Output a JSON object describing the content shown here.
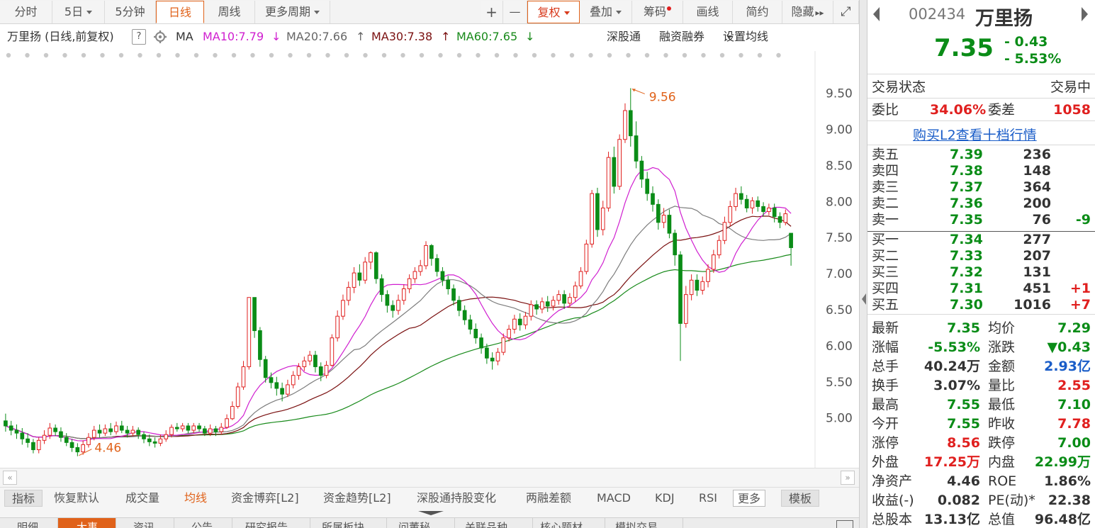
{
  "toolbar": {
    "tabs": [
      "分时",
      "5日",
      "5分钟",
      "日线",
      "周线",
      "更多周期"
    ],
    "active_tab": "日线",
    "zoom_in": "+",
    "zoom_out": "—",
    "fuquan": "复权",
    "overlay": "叠加",
    "chips": "筹码",
    "draw": "画线",
    "simple": "简约",
    "hide": "隐藏",
    "hide_arrows": "▸▸",
    "expand": "⤢"
  },
  "legend": {
    "stock_label": "万里扬 (日线,前复权)",
    "help": "?",
    "ma_label": "MA",
    "ma10": "MA10:7.79",
    "ma10_arrow": "↓",
    "ma20": "MA20:7.66",
    "ma20_arrow": "↑",
    "ma30": "MA30:7.38",
    "ma30_arrow": "↑",
    "ma60": "MA60:7.65",
    "ma60_arrow": "↓",
    "link_sgt": "深股通",
    "link_rzrq": "融资融券",
    "link_ma": "设置均线"
  },
  "colors": {
    "up": "#e0201f",
    "down": "#0a8c17",
    "ma10": "#d01fd0",
    "ma20": "#7d7d7d",
    "ma30": "#7a1010",
    "ma60": "#188a1a",
    "accent": "#e0621a",
    "link": "#1a5dc8"
  },
  "chart_data": {
    "type": "candlestick",
    "y_ticks": [
      "9.50",
      "9.00",
      "8.50",
      "8.00",
      "7.50",
      "7.00",
      "6.50",
      "6.00",
      "5.50",
      "5.00"
    ],
    "ylim": [
      4.3,
      9.8
    ],
    "high_label": "9.56",
    "low_label": "4.46",
    "high_value": 9.56,
    "low_value": 4.46,
    "candles": [
      [
        4.95,
        4.88,
        5.05,
        4.8
      ],
      [
        4.88,
        4.82,
        4.95,
        4.75
      ],
      [
        4.82,
        4.78,
        4.9,
        4.7
      ],
      [
        4.78,
        4.7,
        4.85,
        4.62
      ],
      [
        4.7,
        4.65,
        4.78,
        4.58
      ],
      [
        4.65,
        4.55,
        4.7,
        4.5
      ],
      [
        4.55,
        4.68,
        4.72,
        4.5
      ],
      [
        4.68,
        4.75,
        4.82,
        4.63
      ],
      [
        4.75,
        4.85,
        4.92,
        4.7
      ],
      [
        4.85,
        4.8,
        4.9,
        4.74
      ],
      [
        4.8,
        4.72,
        4.86,
        4.66
      ],
      [
        4.72,
        4.65,
        4.78,
        4.6
      ],
      [
        4.65,
        4.58,
        4.7,
        4.52
      ],
      [
        4.58,
        4.52,
        4.64,
        4.46
      ],
      [
        4.52,
        4.62,
        4.68,
        4.48
      ],
      [
        4.62,
        4.72,
        4.78,
        4.58
      ],
      [
        4.72,
        4.82,
        4.88,
        4.68
      ],
      [
        4.82,
        4.78,
        4.9,
        4.72
      ],
      [
        4.78,
        4.84,
        4.9,
        4.74
      ],
      [
        4.84,
        4.8,
        4.92,
        4.75
      ],
      [
        4.8,
        4.88,
        4.94,
        4.76
      ],
      [
        4.88,
        4.82,
        4.95,
        4.78
      ],
      [
        4.82,
        4.78,
        4.88,
        4.72
      ],
      [
        4.78,
        4.82,
        4.88,
        4.74
      ],
      [
        4.82,
        4.76,
        4.86,
        4.7
      ],
      [
        4.76,
        4.7,
        4.8,
        4.64
      ],
      [
        4.7,
        4.66,
        4.76,
        4.6
      ],
      [
        4.66,
        4.64,
        4.72,
        4.58
      ],
      [
        4.64,
        4.7,
        4.76,
        4.6
      ],
      [
        4.7,
        4.76,
        4.82,
        4.66
      ],
      [
        4.76,
        4.86,
        4.9,
        4.72
      ],
      [
        4.86,
        4.84,
        4.92,
        4.8
      ],
      [
        4.84,
        4.88,
        4.92,
        4.8
      ],
      [
        4.88,
        4.82,
        4.92,
        4.78
      ],
      [
        4.82,
        4.88,
        4.92,
        4.78
      ],
      [
        4.88,
        4.84,
        4.92,
        4.8
      ],
      [
        4.84,
        4.78,
        4.88,
        4.74
      ],
      [
        4.78,
        4.84,
        4.9,
        4.74
      ],
      [
        4.84,
        4.8,
        4.88,
        4.74
      ],
      [
        4.8,
        4.86,
        4.92,
        4.76
      ],
      [
        4.86,
        4.98,
        5.04,
        4.84
      ],
      [
        4.98,
        5.15,
        5.22,
        4.96
      ],
      [
        5.15,
        5.42,
        5.48,
        5.12
      ],
      [
        5.42,
        5.7,
        5.78,
        5.38
      ],
      [
        5.7,
        6.66,
        6.66,
        5.66
      ],
      [
        6.66,
        6.2,
        6.66,
        6.1
      ],
      [
        6.2,
        5.8,
        6.25,
        5.7
      ],
      [
        5.8,
        5.55,
        5.85,
        5.48
      ],
      [
        5.55,
        5.48,
        5.62,
        5.4
      ],
      [
        5.48,
        5.4,
        5.56,
        5.3
      ],
      [
        5.4,
        5.32,
        5.48,
        5.22
      ],
      [
        5.32,
        5.45,
        5.52,
        5.28
      ],
      [
        5.45,
        5.58,
        5.64,
        5.4
      ],
      [
        5.58,
        5.7,
        5.75,
        5.52
      ],
      [
        5.7,
        5.78,
        5.84,
        5.64
      ],
      [
        5.78,
        5.86,
        5.92,
        5.72
      ],
      [
        5.86,
        5.7,
        5.92,
        5.62
      ],
      [
        5.7,
        5.58,
        5.76,
        5.5
      ],
      [
        5.58,
        5.72,
        5.78,
        5.54
      ],
      [
        5.72,
        6.1,
        6.15,
        5.7
      ],
      [
        6.1,
        6.4,
        6.48,
        6.05
      ],
      [
        6.4,
        6.62,
        6.7,
        6.35
      ],
      [
        6.62,
        6.8,
        6.88,
        6.55
      ],
      [
        6.8,
        7.0,
        7.08,
        6.72
      ],
      [
        7.0,
        6.9,
        7.12,
        6.82
      ],
      [
        6.9,
        7.15,
        7.22,
        6.85
      ],
      [
        7.15,
        7.28,
        7.3,
        7.05
      ],
      [
        7.28,
        6.92,
        7.3,
        6.85
      ],
      [
        6.92,
        6.7,
        6.98,
        6.6
      ],
      [
        6.7,
        6.55,
        6.76,
        6.45
      ],
      [
        6.55,
        6.48,
        6.62,
        6.38
      ],
      [
        6.48,
        6.62,
        6.7,
        6.42
      ],
      [
        6.62,
        6.78,
        6.84,
        6.56
      ],
      [
        6.78,
        6.92,
        6.98,
        6.72
      ],
      [
        6.92,
        7.02,
        7.08,
        6.86
      ],
      [
        7.02,
        7.1,
        7.18,
        6.96
      ],
      [
        7.1,
        7.38,
        7.44,
        7.05
      ],
      [
        7.38,
        7.2,
        7.4,
        7.1
      ],
      [
        7.2,
        7.02,
        7.26,
        6.95
      ],
      [
        7.02,
        6.9,
        7.08,
        6.82
      ],
      [
        6.9,
        6.78,
        6.96,
        6.7
      ],
      [
        6.78,
        6.62,
        6.84,
        6.55
      ],
      [
        6.62,
        6.48,
        6.68,
        6.4
      ],
      [
        6.48,
        6.35,
        6.55,
        6.28
      ],
      [
        6.35,
        6.22,
        6.42,
        6.15
      ],
      [
        6.22,
        6.1,
        6.3,
        6.02
      ],
      [
        6.1,
        5.96,
        6.16,
        5.88
      ],
      [
        5.96,
        5.82,
        6.02,
        5.74
      ],
      [
        5.82,
        5.78,
        5.9,
        5.66
      ],
      [
        5.78,
        5.9,
        5.96,
        5.72
      ],
      [
        5.9,
        6.1,
        6.16,
        5.86
      ],
      [
        6.1,
        6.22,
        6.28,
        6.05
      ],
      [
        6.22,
        6.36,
        6.42,
        6.16
      ],
      [
        6.36,
        6.28,
        6.44,
        6.2
      ],
      [
        6.28,
        6.4,
        6.46,
        6.22
      ],
      [
        6.4,
        6.56,
        6.62,
        6.34
      ],
      [
        6.56,
        6.5,
        6.62,
        6.42
      ],
      [
        6.5,
        6.6,
        6.66,
        6.44
      ],
      [
        6.6,
        6.54,
        6.68,
        6.46
      ],
      [
        6.54,
        6.62,
        6.68,
        6.48
      ],
      [
        6.62,
        6.7,
        6.76,
        6.56
      ],
      [
        6.7,
        6.58,
        6.76,
        6.5
      ],
      [
        6.58,
        6.66,
        6.72,
        6.52
      ],
      [
        6.66,
        6.82,
        6.88,
        6.6
      ],
      [
        6.82,
        7.02,
        7.08,
        6.78
      ],
      [
        7.02,
        7.4,
        7.46,
        6.98
      ],
      [
        7.4,
        8.1,
        8.15,
        7.35
      ],
      [
        8.1,
        7.6,
        8.18,
        7.5
      ],
      [
        7.6,
        7.9,
        8.0,
        7.52
      ],
      [
        7.9,
        8.6,
        8.68,
        7.85
      ],
      [
        8.6,
        8.2,
        8.75,
        8.1
      ],
      [
        8.2,
        8.85,
        8.92,
        8.15
      ],
      [
        8.85,
        9.25,
        9.35,
        8.8
      ],
      [
        9.25,
        8.9,
        9.56,
        8.75
      ],
      [
        8.9,
        8.55,
        9.1,
        8.45
      ],
      [
        8.55,
        8.3,
        8.62,
        8.18
      ],
      [
        8.3,
        8.1,
        8.4,
        8.0
      ],
      [
        8.1,
        7.95,
        8.2,
        7.85
      ],
      [
        7.95,
        7.7,
        8.02,
        7.6
      ],
      [
        7.7,
        7.8,
        7.9,
        7.62
      ],
      [
        7.8,
        7.55,
        7.88,
        7.48
      ],
      [
        7.55,
        7.25,
        7.6,
        7.1
      ],
      [
        7.25,
        6.3,
        7.3,
        5.78
      ],
      [
        6.3,
        6.7,
        6.82,
        6.24
      ],
      [
        6.7,
        6.9,
        6.98,
        6.62
      ],
      [
        6.9,
        6.76,
        6.98,
        6.68
      ],
      [
        6.76,
        6.88,
        6.95,
        6.7
      ],
      [
        6.88,
        7.05,
        7.12,
        6.8
      ],
      [
        7.05,
        7.25,
        7.32,
        7.0
      ],
      [
        7.25,
        7.45,
        7.52,
        7.2
      ],
      [
        7.45,
        7.7,
        7.78,
        7.4
      ],
      [
        7.7,
        7.92,
        8.0,
        7.65
      ],
      [
        7.92,
        8.1,
        8.18,
        7.86
      ],
      [
        8.1,
        8.02,
        8.2,
        7.95
      ],
      [
        8.02,
        7.9,
        8.08,
        7.84
      ],
      [
        7.9,
        8.0,
        8.05,
        7.82
      ],
      [
        8.0,
        7.92,
        8.06,
        7.85
      ],
      [
        7.92,
        7.85,
        7.98,
        7.78
      ],
      [
        7.85,
        7.9,
        7.96,
        7.8
      ],
      [
        7.9,
        7.78,
        7.96,
        7.7
      ],
      [
        7.78,
        7.7,
        7.84,
        7.62
      ],
      [
        7.7,
        7.82,
        7.88,
        7.66
      ],
      [
        7.55,
        7.35,
        7.55,
        7.1
      ]
    ]
  },
  "scroll": {
    "left": "«",
    "right": "»"
  },
  "indicator_tabs": [
    "指标",
    "恢复默认",
    "成交量",
    "均线",
    "资金博弈[L2]",
    "资金趋势[L2]",
    "深股通持股变化",
    "两融差额",
    "MACD",
    "KDJ",
    "RSI",
    "更多",
    "模板"
  ],
  "bottom_tabs": [
    "明细",
    "大事",
    "资讯",
    "公告",
    "研究报告",
    "所属板块",
    "问董秘",
    "关联品种",
    "核心题材",
    "模拟交易"
  ],
  "quote": {
    "code": "002434",
    "name": "万里扬",
    "price": "7.35",
    "change": "- 0.43",
    "change_pct": "- 5.53%",
    "status_label": "交易状态",
    "status_value": "交易中",
    "weibi_label": "委比",
    "weibi_value": "34.06%",
    "weicha_label": "委差",
    "weicha_value": "1058",
    "l2_link": "购买L2查看十档行情",
    "asks": [
      {
        "label": "卖五",
        "price": "7.39",
        "vol": "236",
        "delta": ""
      },
      {
        "label": "卖四",
        "price": "7.38",
        "vol": "148",
        "delta": ""
      },
      {
        "label": "卖三",
        "price": "7.37",
        "vol": "364",
        "delta": ""
      },
      {
        "label": "卖二",
        "price": "7.36",
        "vol": "200",
        "delta": ""
      },
      {
        "label": "卖一",
        "price": "7.35",
        "vol": "76",
        "delta": "-9"
      }
    ],
    "bids": [
      {
        "label": "买一",
        "price": "7.34",
        "vol": "277",
        "delta": ""
      },
      {
        "label": "买二",
        "price": "7.33",
        "vol": "207",
        "delta": ""
      },
      {
        "label": "买三",
        "price": "7.32",
        "vol": "131",
        "delta": ""
      },
      {
        "label": "买四",
        "price": "7.31",
        "vol": "451",
        "delta": "+1"
      },
      {
        "label": "买五",
        "price": "7.30",
        "vol": "1016",
        "delta": "+7"
      }
    ],
    "stats": [
      [
        "最新",
        "7.35",
        "均价",
        "7.29"
      ],
      [
        "涨幅",
        "-5.53%",
        "涨跌",
        "▼0.43"
      ],
      [
        "总手",
        "40.24万",
        "金额",
        "2.93亿"
      ],
      [
        "换手",
        "3.07%",
        "量比",
        "2.55"
      ],
      [
        "最高",
        "7.55",
        "最低",
        "7.10"
      ],
      [
        "今开",
        "7.55",
        "昨收",
        "7.78"
      ],
      [
        "涨停",
        "8.56",
        "跌停",
        "7.00"
      ],
      [
        "外盘",
        "17.25万",
        "内盘",
        "22.99万"
      ],
      [
        "净资产",
        "4.46",
        "ROE",
        "1.86%"
      ],
      [
        "收益(-)",
        "0.082",
        "PE(动)*",
        "22.38"
      ],
      [
        "总股本",
        "13.13亿",
        "总值",
        "96.48亿"
      ]
    ]
  }
}
